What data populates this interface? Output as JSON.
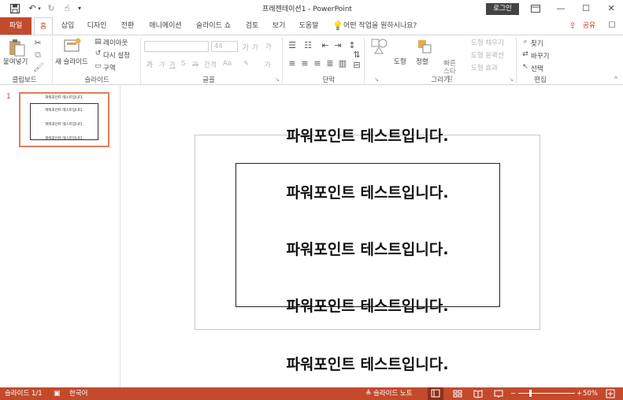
{
  "window": {
    "title": "프레젠테이션1  -  PowerPoint",
    "login_label": "로그인",
    "qat_icons": [
      "save-icon",
      "undo-icon",
      "redo-icon",
      "touch-mode-icon",
      "customize-qat-icon"
    ]
  },
  "tabs": [
    "파일",
    "홈",
    "삽입",
    "디자인",
    "전환",
    "애니메이션",
    "슬라이드 쇼",
    "검토",
    "보기",
    "도움말"
  ],
  "tell_me": "어떤 작업을 원하시나요?",
  "share_label": "공유",
  "ribbon": {
    "clipboard": {
      "label": "클립보드",
      "paste": "붙여넣기"
    },
    "slides": {
      "label": "슬라이드",
      "new_slide": "새 슬라이드",
      "layout": "레이아웃",
      "reset": "다시 설정",
      "section": "구역"
    },
    "font": {
      "label": "글꼴",
      "size": "44",
      "bold": "가",
      "italic": "가",
      "underline": "가",
      "strike": "가",
      "shadow": "S",
      "spacing": "간격",
      "case": "Aa",
      "grow": "가",
      "shrink": "가",
      "clear": "가",
      "color": "가"
    },
    "paragraph": {
      "label": "단락"
    },
    "drawing": {
      "label": "그리기",
      "shapes": "도형",
      "arrange": "정렬",
      "quick_styles": "빠른 스타일",
      "fill": "도형 채우기",
      "outline": "도형 윤곽선",
      "effects": "도형 효과"
    },
    "editing": {
      "label": "편집",
      "find": "찾기",
      "replace": "바꾸기",
      "select": "선택"
    }
  },
  "thumbnail": {
    "number": "1",
    "lines": [
      "파워포인트 테스트입니다.",
      "파워포인트 테스트입니다.",
      "파워포인트 테스트입니다.",
      "파워포인트 테스트입니다."
    ]
  },
  "slide": {
    "lines": [
      "파워포인트 테스트입니다.",
      "파워포인트 테스트입니다.",
      "파워포인트 테스트입니다.",
      "파워포인트 테스트입니다.",
      "파워포인트 테스트입니다."
    ]
  },
  "status": {
    "slide_counter": "슬라이드 1/1",
    "language": "한국어",
    "notes": "슬라이드 노트",
    "zoom": "50%"
  },
  "colors": {
    "accent": "#c34a2c",
    "thumb_border": "#e27c5c"
  }
}
